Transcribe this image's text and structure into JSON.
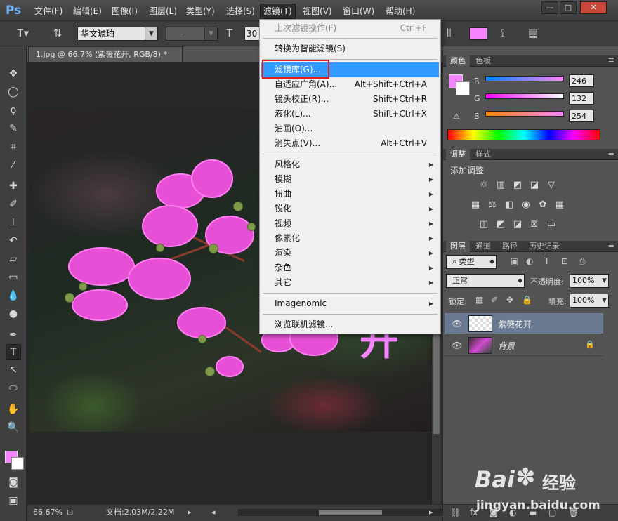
{
  "app": {
    "logo": "Ps",
    "menus": [
      "文件(F)",
      "编辑(E)",
      "图像(I)",
      "图层(L)",
      "类型(Y)",
      "选择(S)",
      "滤镜(T)",
      "视图(V)",
      "窗口(W)",
      "帮助(H)"
    ],
    "active_menu": "滤镜(T)",
    "window_buttons": [
      "—",
      "□",
      "✕"
    ]
  },
  "options_bar": {
    "font_family": "华文琥珀",
    "font_style": "-",
    "font_size": "30",
    "text_color": "#f684fe"
  },
  "document": {
    "tab_title": "1.jpg @ 66.7% (紫薇花开, RGB/8) *",
    "overlay_text": "开",
    "zoom": "66.67%",
    "doc_size": "文档:2.03M/2.22M"
  },
  "filter_menu": {
    "items": [
      {
        "label": "上次滤镜操作(F)",
        "shortcut": "Ctrl+F",
        "disabled": true
      },
      {
        "label": "转换为智能滤镜(S)",
        "shortcut": ""
      },
      {
        "label": "滤镜库(G)...",
        "shortcut": "",
        "highlighted": true
      },
      {
        "label": "自适应广角(A)...",
        "shortcut": "Alt+Shift+Ctrl+A"
      },
      {
        "label": "镜头校正(R)...",
        "shortcut": "Shift+Ctrl+R"
      },
      {
        "label": "液化(L)...",
        "shortcut": "Shift+Ctrl+X"
      },
      {
        "label": "油画(O)...",
        "shortcut": ""
      },
      {
        "label": "消失点(V)...",
        "shortcut": "Alt+Ctrl+V"
      },
      {
        "label": "风格化",
        "submenu": true
      },
      {
        "label": "模糊",
        "submenu": true
      },
      {
        "label": "扭曲",
        "submenu": true
      },
      {
        "label": "锐化",
        "submenu": true
      },
      {
        "label": "视频",
        "submenu": true
      },
      {
        "label": "像素化",
        "submenu": true
      },
      {
        "label": "渲染",
        "submenu": true
      },
      {
        "label": "杂色",
        "submenu": true
      },
      {
        "label": "其它",
        "submenu": true
      },
      {
        "label": "Imagenomic",
        "submenu": true
      },
      {
        "label": "浏览联机滤镜...",
        "shortcut": ""
      }
    ]
  },
  "color_panel": {
    "tabs": [
      "颜色",
      "色板"
    ],
    "channels": [
      {
        "label": "R",
        "value": "246"
      },
      {
        "label": "G",
        "value": "132"
      },
      {
        "label": "B",
        "value": "254"
      }
    ],
    "foreground": "#f684fe"
  },
  "adjust_panel": {
    "tabs": [
      "调整",
      "样式"
    ],
    "title": "添加调整"
  },
  "layers_panel": {
    "tabs": [
      "图层",
      "通道",
      "路径",
      "历史记录"
    ],
    "filter_kind": "类型",
    "blend_mode": "正常",
    "opacity_label": "不透明度:",
    "opacity": "100%",
    "lock_label": "锁定:",
    "fill_label": "填充:",
    "fill": "100%",
    "layers": [
      {
        "name": "紫薇花开",
        "selected": true
      },
      {
        "name": "背景",
        "locked": true
      }
    ]
  },
  "watermark": {
    "brand": "Bai",
    "brand2": "经验",
    "url": "jingyan.baidu.com"
  }
}
